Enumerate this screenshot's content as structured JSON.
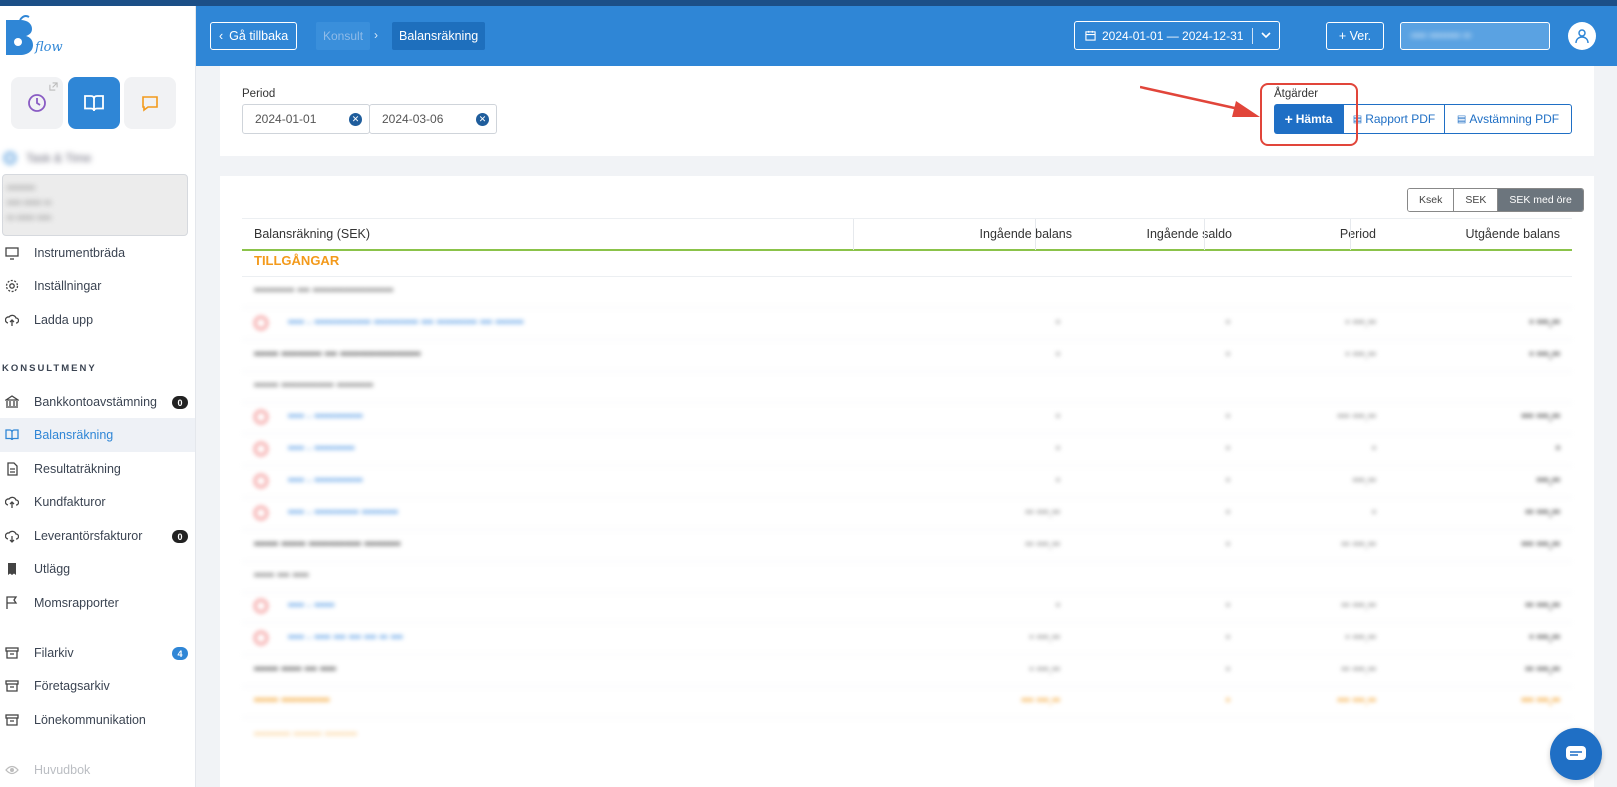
{
  "app": {
    "logo_text": "flow"
  },
  "sidebar": {
    "time_title": "Task & Time",
    "time_box_lines": [
      "••••••••",
      "•••• ••••• ••",
      "•• ••••• ••••"
    ],
    "items": [
      {
        "label": "Instrumentbräda",
        "icon": "monitor-icon"
      },
      {
        "label": "Inställningar",
        "icon": "gear-icon"
      },
      {
        "label": "Ladda upp",
        "icon": "cloud-upload-icon"
      }
    ],
    "section_label": "KONSULTMENY",
    "consult_items": [
      {
        "label": "Bankkontoavstämning",
        "icon": "bank-icon",
        "badge": "0"
      },
      {
        "label": "Balansräkning",
        "icon": "book-icon",
        "active": true
      },
      {
        "label": "Resultaträkning",
        "icon": "document-icon"
      },
      {
        "label": "Kundfakturor",
        "icon": "cloud-upload-icon"
      },
      {
        "label": "Leverantörsfakturor",
        "icon": "cloud-download-icon",
        "badge": "0"
      },
      {
        "label": "Utlägg",
        "icon": "receipt-icon"
      },
      {
        "label": "Momsrapporter",
        "icon": "flag-icon"
      }
    ],
    "archive_items": [
      {
        "label": "Filarkiv",
        "icon": "archive-icon",
        "badge": "4"
      },
      {
        "label": "Företagsarkiv",
        "icon": "archive-icon"
      },
      {
        "label": "Lönekommunikation",
        "icon": "archive-icon"
      }
    ],
    "bottom_item": "Huvudbok"
  },
  "header": {
    "back_label": "Gå tillbaka",
    "crumb_parent": "Konsult",
    "crumb_current": "Balansräkning",
    "date_range": "2024-01-01 — 2024-12-31",
    "ver_label": "+ Ver.",
    "blurred_button": "•••• •••••••• ••"
  },
  "filters": {
    "period_label": "Period",
    "date_from": "2024-01-01",
    "date_to": "2024-03-06",
    "actions_label": "Åtgärder",
    "btn_fetch": "Hämta",
    "btn_report": "Rapport PDF",
    "btn_reconcile": "Avstämning PDF"
  },
  "units": {
    "options": [
      "Ksek",
      "SEK",
      "SEK med öre"
    ],
    "selected": "SEK med öre"
  },
  "table": {
    "headers": [
      "Balansräkning (SEK)",
      "Ingående balans",
      "Ingående saldo",
      "Period",
      "Utgående balans"
    ],
    "section": "TILLGÅNGAR",
    "rows": [
      {
        "type": "group",
        "label": "•••••••••• ••• ••••••••••••••••••••"
      },
      {
        "type": "link",
        "label": "•••• - •••••••••••••• ••••••••••• ••• •••••••••• ••• •••••••",
        "v": [
          "•",
          "•",
          "• •••,••",
          "• •••,••"
        ]
      },
      {
        "type": "sum",
        "label": "•••••• •••••••••• ••• ••••••••••••••••••••",
        "v": [
          "•",
          "•",
          "• •••,••",
          "• •••,••"
        ]
      },
      {
        "type": "group",
        "label": "•••••• ••••••••••••• •••••••••"
      },
      {
        "type": "link",
        "label": "•••• - ••••••••••••",
        "v": [
          "•",
          "•",
          "••• •••,••",
          "••• •••,••"
        ]
      },
      {
        "type": "link",
        "label": "•••• - ••••••••••",
        "v": [
          "•",
          "•",
          "•",
          "•"
        ]
      },
      {
        "type": "link",
        "label": "•••• - ••••••••••••",
        "v": [
          "•",
          "•",
          "•••,••",
          "•••,••"
        ]
      },
      {
        "type": "link",
        "label": "•••• - ••••••••••• •••••••••",
        "v": [
          "•• •••,••",
          "•",
          "•",
          "•• •••,••"
        ]
      },
      {
        "type": "sum",
        "label": "•••••• •••••• ••••••••••••• •••••••••",
        "v": [
          "•• •••,••",
          "•",
          "•• •••,••",
          "••• •••,••"
        ]
      },
      {
        "type": "group",
        "label": "••••• ••• ••••"
      },
      {
        "type": "link",
        "label": "•••• - •••••",
        "v": [
          "•",
          "•",
          "•• •••,••",
          "•• •••,••"
        ]
      },
      {
        "type": "link",
        "label": "•••• - •••• ••• ••• ••• •• •••",
        "v": [
          "• •••,••",
          "•",
          "• •••,••",
          "• •••,••"
        ]
      },
      {
        "type": "sum",
        "label": "•••••• ••••• ••• ••••",
        "v": [
          "• •••,••",
          "•",
          "•• •••,••",
          "•• •••,••"
        ]
      },
      {
        "type": "total",
        "label": "•••••• ••••••••••••",
        "v": [
          "••• •••,••",
          "•",
          "••• •••,••",
          "••• •••,••"
        ]
      },
      {
        "type": "total-sub",
        "label": "••••••••• ••••••• ••••••••",
        "v": [
          "",
          "",
          "",
          ""
        ]
      }
    ]
  },
  "colors": {
    "primary": "#2f86d6",
    "accent_orange": "#f39a1b",
    "highlight_red": "#e1453a",
    "green_rule": "#8bc34a"
  }
}
